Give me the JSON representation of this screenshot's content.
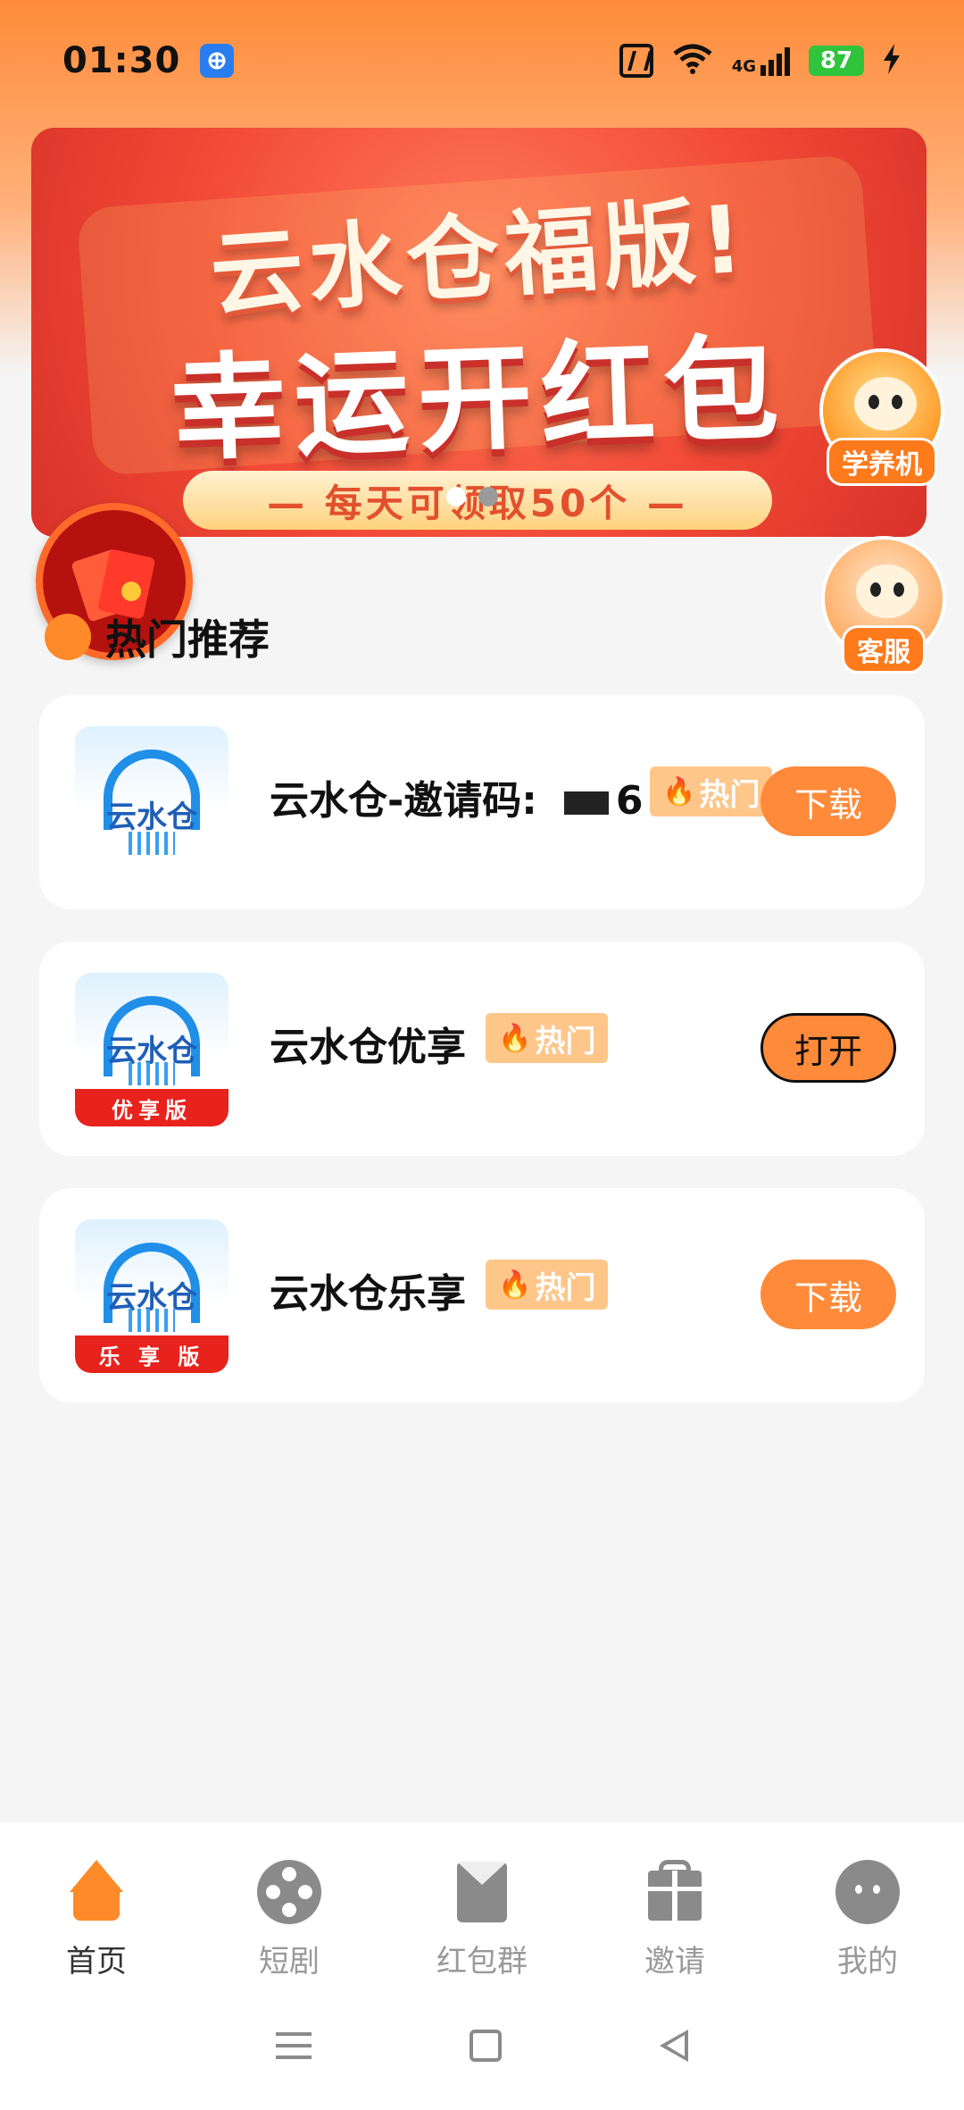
{
  "status_bar": {
    "time": "01:30",
    "network": "4G",
    "battery": "87",
    "icons": [
      "app-notification-icon",
      "nfc-icon",
      "wifi-icon",
      "signal-icon",
      "battery-icon",
      "charging-icon"
    ]
  },
  "banner": {
    "title_line1": "云水仓福版!",
    "title_line2": "幸运开红包",
    "subtitle": "— 每天可领取50个 —",
    "dots": 2,
    "active_dot": 0
  },
  "floating": {
    "study_label": "学养机",
    "service_label": "客服"
  },
  "section": {
    "title": "热门推荐"
  },
  "apps": [
    {
      "name": "云水仓-邀请码:",
      "code_tail": "6",
      "hot_label": "热门",
      "action": "下载",
      "icon_brand": "云水仓",
      "icon_ribbon": ""
    },
    {
      "name": "云水仓优享",
      "hot_label": "热门",
      "action": "打开",
      "icon_brand": "云水仓",
      "icon_ribbon": "优享版"
    },
    {
      "name": "云水仓乐享",
      "hot_label": "热门",
      "action": "下载",
      "icon_brand": "云水仓",
      "icon_ribbon": "乐 享 版"
    }
  ],
  "bottom_nav": {
    "items": [
      {
        "label": "首页",
        "icon": "home-icon",
        "active": true
      },
      {
        "label": "短剧",
        "icon": "film-reel-icon",
        "active": false
      },
      {
        "label": "红包群",
        "icon": "red-envelope-icon",
        "active": false
      },
      {
        "label": "邀请",
        "icon": "gift-icon",
        "active": false
      },
      {
        "label": "我的",
        "icon": "profile-face-icon",
        "active": false
      }
    ]
  },
  "colors": {
    "accent": "#ff8a3a",
    "hot_badge": "#ffc68a",
    "banner_red": "#f24a36"
  }
}
